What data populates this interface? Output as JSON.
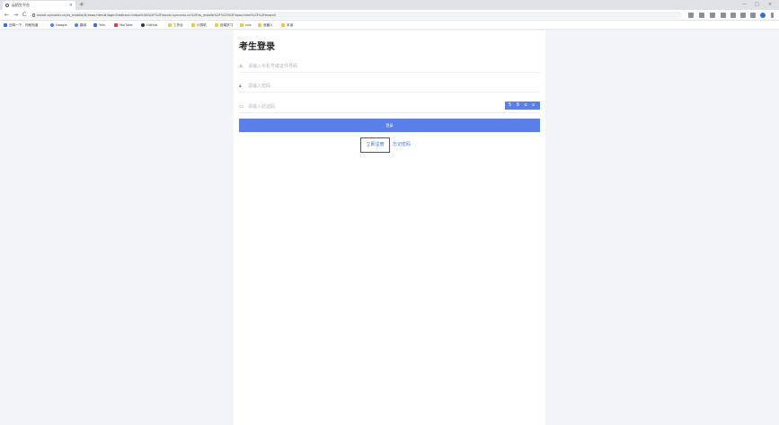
{
  "browser": {
    "tab_title": "云招生平台",
    "tab_close": "×",
    "new_tab": "+",
    "window_controls": [
      "—",
      "□",
      "×"
    ],
    "nav": {
      "back": "←",
      "forward": "→",
      "reload": "C"
    },
    "url": "zsrzxt.syncedu.cn/zs_mobile/#/zsws.html#/login?redirect=https%3A%2F%2Fzsrzxt.syncedu.cn%2Fzs_mobile%2F%23%2Fzsws.html%23%2Fexamll",
    "bookmarks": [
      {
        "label": "旧驿一下，你就知道",
        "icon": "b"
      },
      {
        "label": "Google",
        "icon": "g"
      },
      {
        "label": "翻译",
        "icon": "g"
      },
      {
        "label": "Yuls",
        "icon": "b"
      },
      {
        "label": "YouTube",
        "icon": "r"
      },
      {
        "label": "GitHub",
        "icon": "d"
      },
      {
        "label": "工作台",
        "icon": "y"
      },
      {
        "label": "计算机",
        "icon": "y"
      },
      {
        "label": "前端学习",
        "icon": "y"
      },
      {
        "label": "vue",
        "icon": "y"
      },
      {
        "label": "收藏人",
        "icon": "y"
      },
      {
        "label": "未读",
        "icon": "y"
      }
    ]
  },
  "login": {
    "title": "考生登录",
    "account_placeholder": "请输入手机号或证件号码",
    "password_placeholder": "请输入密码",
    "captcha_placeholder": "请输入验证码",
    "captcha_code": "5 9 u x",
    "submit_label": "登录",
    "register_label": "立即注册",
    "forgot_label": "忘记密码"
  }
}
